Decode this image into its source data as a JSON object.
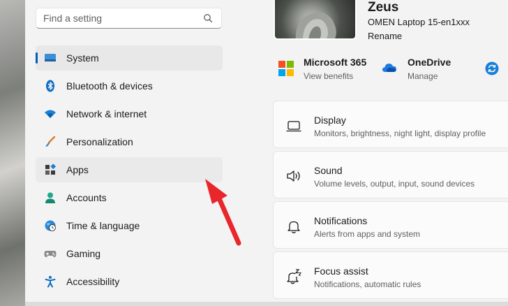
{
  "search": {
    "placeholder": "Find a setting"
  },
  "nav": [
    {
      "label": "System",
      "icon": "system-icon",
      "selected": true
    },
    {
      "label": "Bluetooth & devices",
      "icon": "bluetooth-icon"
    },
    {
      "label": "Network & internet",
      "icon": "wifi-icon"
    },
    {
      "label": "Personalization",
      "icon": "brush-icon"
    },
    {
      "label": "Apps",
      "icon": "apps-icon",
      "hovered": true
    },
    {
      "label": "Accounts",
      "icon": "person-icon"
    },
    {
      "label": "Time & language",
      "icon": "globe-clock-icon"
    },
    {
      "label": "Gaming",
      "icon": "gamepad-icon"
    },
    {
      "label": "Accessibility",
      "icon": "accessibility-icon"
    }
  ],
  "profile": {
    "user_name": "Zeus",
    "device_name": "OMEN Laptop 15-en1xxx",
    "rename": "Rename"
  },
  "promos": [
    {
      "title": "Microsoft 365",
      "subtitle": "View benefits",
      "icon": "microsoft-logo-icon"
    },
    {
      "title": "OneDrive",
      "subtitle": "Manage",
      "icon": "onedrive-cloud-icon"
    }
  ],
  "sync_icon": "sync-icon",
  "cards": [
    {
      "title": "Display",
      "subtitle": "Monitors, brightness, night light, display profile",
      "icon": "display-icon"
    },
    {
      "title": "Sound",
      "subtitle": "Volume levels, output, input, sound devices",
      "icon": "speaker-icon"
    },
    {
      "title": "Notifications",
      "subtitle": "Alerts from apps and system",
      "icon": "bell-icon"
    },
    {
      "title": "Focus assist",
      "subtitle": "Notifications, automatic rules",
      "icon": "focus-assist-icon"
    }
  ],
  "colors": {
    "accent": "#005fb8",
    "annotation_arrow": "#e8262b"
  }
}
